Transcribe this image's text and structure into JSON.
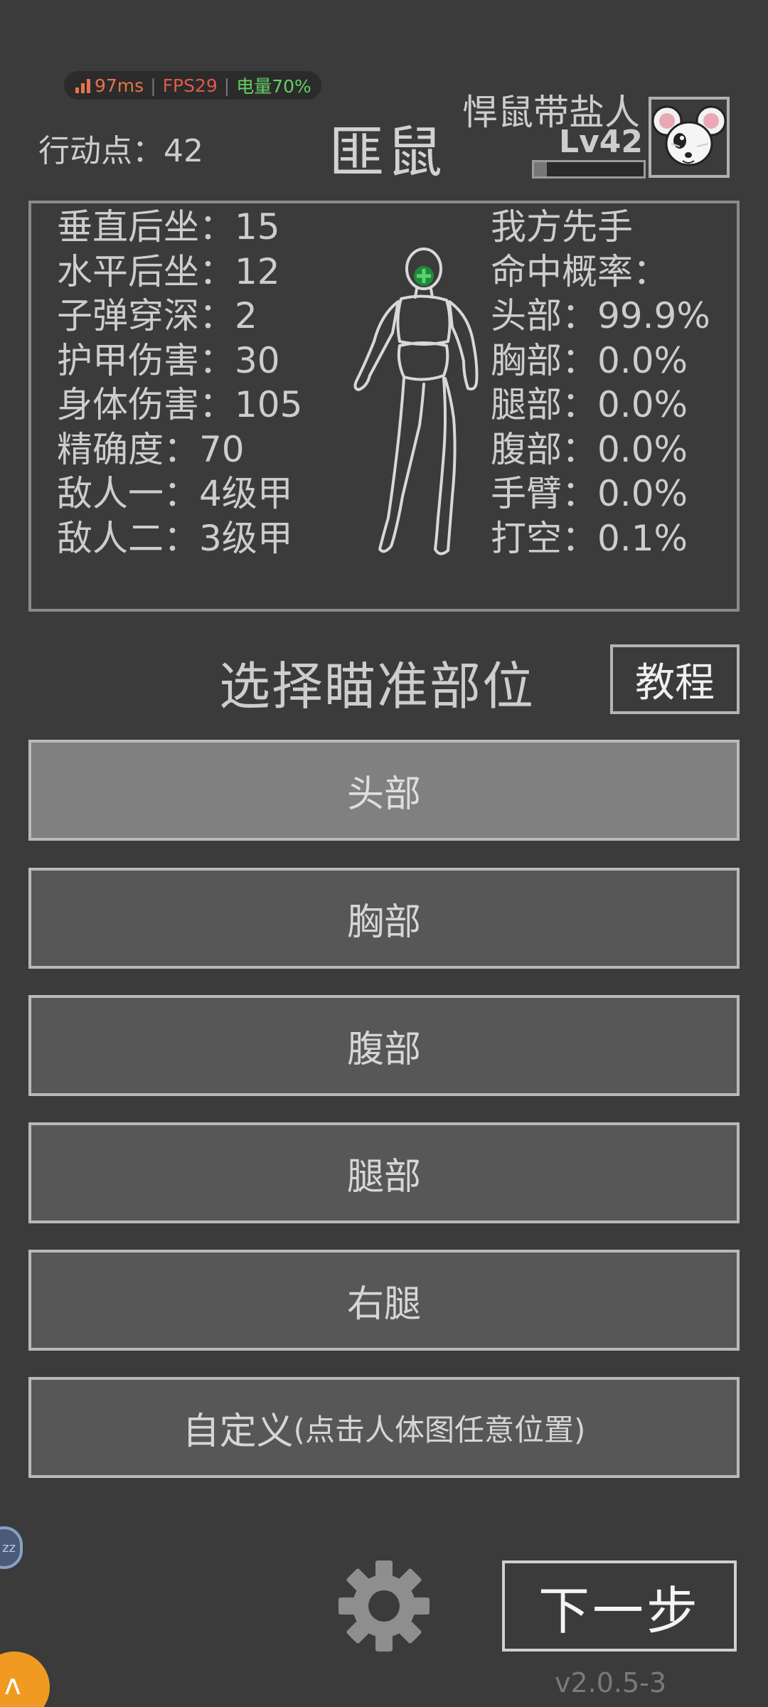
{
  "status": {
    "ping": "97ms",
    "fps": "FPS29",
    "battery": "电量70%",
    "colors": {
      "ping": "#e8734a",
      "fps": "#e05a4a",
      "battery": "#63d063"
    }
  },
  "header": {
    "action_points": "行动点：42",
    "enemy_name": "匪鼠",
    "player_name": "悍鼠带盐人",
    "player_level": "Lv42",
    "xp_progress": 0.12,
    "avatar_icon": "white-mouse-avatar"
  },
  "stats": {
    "left": [
      "垂直后坐：15",
      "水平后坐：12",
      "子弹穿深：2",
      "护甲伤害：30",
      "身体伤害：105",
      "精确度：70",
      "敌人一：4级甲",
      "敌人二：3级甲"
    ],
    "right": [
      "我方先手",
      "命中概率：",
      "头部：99.9%",
      "胸部：0.0%",
      "腿部：0.0%",
      "腹部：0.0%",
      "手臂：0.0%",
      "打空：0.1%"
    ]
  },
  "aim": {
    "title": "选择瞄准部位",
    "tutorial": "教程",
    "parts": [
      "头部",
      "胸部",
      "腹部",
      "腿部",
      "右腿"
    ],
    "selected_index": 0,
    "custom_main": "自定义",
    "custom_sub": "(点击人体图任意位置)"
  },
  "footer": {
    "zz_badge": "zz",
    "settings_icon": "gear-icon",
    "next": "下一步",
    "version": "v2.0.5-3"
  }
}
